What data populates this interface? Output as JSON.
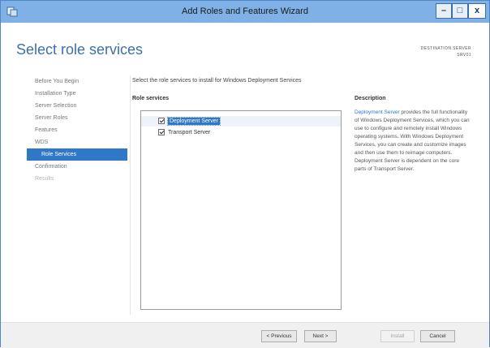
{
  "window": {
    "title": "Add Roles and Features Wizard",
    "controls": {
      "minimize": "–",
      "maximize": "□",
      "close": "x"
    }
  },
  "page": {
    "heading": "Select role services",
    "destination_label": "DESTINATION SERVER",
    "destination_server": "SRV01"
  },
  "nav": {
    "items": [
      {
        "label": "Before You Begin",
        "state": "normal"
      },
      {
        "label": "Installation Type",
        "state": "normal"
      },
      {
        "label": "Server Selection",
        "state": "normal"
      },
      {
        "label": "Server Roles",
        "state": "normal"
      },
      {
        "label": "Features",
        "state": "normal"
      },
      {
        "label": "WDS",
        "state": "normal"
      },
      {
        "label": "Role Services",
        "state": "selected"
      },
      {
        "label": "Confirmation",
        "state": "normal"
      },
      {
        "label": "Results",
        "state": "disabled"
      }
    ]
  },
  "main": {
    "instruction": "Select the role services to install for Windows Deployment Services",
    "role_services_label": "Role services",
    "role_services": [
      {
        "label": "Deployment Server",
        "checked": true,
        "selected": true
      },
      {
        "label": "Transport Server",
        "checked": true,
        "selected": false
      }
    ]
  },
  "description": {
    "heading": "Description",
    "link": "Deployment Server",
    "text": "provides the full functionality of Windows Deployment Services, which you can use to configure and remotely install Windows operating systems. With Windows Deployment Services, you can create and customize images and then use them to reimage computers. Deployment Server is dependent on the core parts of Transport Server."
  },
  "buttons": {
    "previous": "< Previous",
    "next": "Next >",
    "install": "Install",
    "cancel": "Cancel"
  },
  "colors": {
    "titlebar": "#7fb1e6",
    "accent": "#2f77c7",
    "heading": "#3d6fa8"
  }
}
